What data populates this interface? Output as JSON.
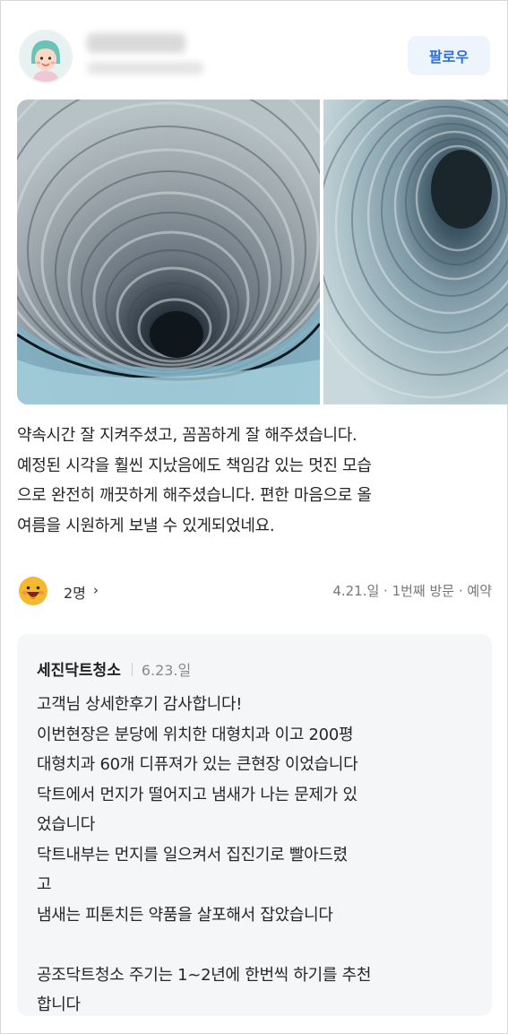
{
  "header": {
    "follow_label": "팔로우"
  },
  "review": {
    "lines": [
      "약속시간 잘 지켜주셨고, 꼼꼼하게 잘 해주셨습니다.",
      "예정된 시각을 훨씬 지났음에도 책임감 있는 멋진 모습",
      "으로 완전히 깨끗하게 해주셨습니다. 편한 마음으로 올",
      "여름을 시원하게 보낼 수 있게되었네요."
    ]
  },
  "reactions": {
    "count_label": "2명",
    "chevron": "›",
    "visit_info": "4.21.일 · 1번째 방문 · 예약"
  },
  "reply": {
    "owner_name": "세진닥트청소",
    "date": "6.23.일",
    "lines": [
      "고객님 상세한후기 감사합니다!",
      "이번현장은 분당에 위치한 대형치과 이고 200평",
      "대형치과 60개 디퓨져가 있는 큰현장 이었습니다",
      "닥트에서 먼지가 떨어지고 냄새가 나는 문제가 있",
      "었습니다",
      "닥트내부는 먼지를 일으켜서 집진기로 빨아드렸",
      "고",
      "냄새는 피톤치든 약품을 살포해서 잡았습니다",
      "",
      "공조닥트청소 주기는 1~2년에 한번씩 하기를 추천",
      "합니다"
    ]
  },
  "icons": {
    "avatar": "user-avatar-icon",
    "reaction": "smile-face-icon",
    "chevron": "chevron-right-icon"
  },
  "colors": {
    "follow_text": "#2c6fd8",
    "follow_bg": "#eef4fc",
    "reply_bg": "#f5f6f8",
    "reaction_face": "#f5b82e"
  }
}
